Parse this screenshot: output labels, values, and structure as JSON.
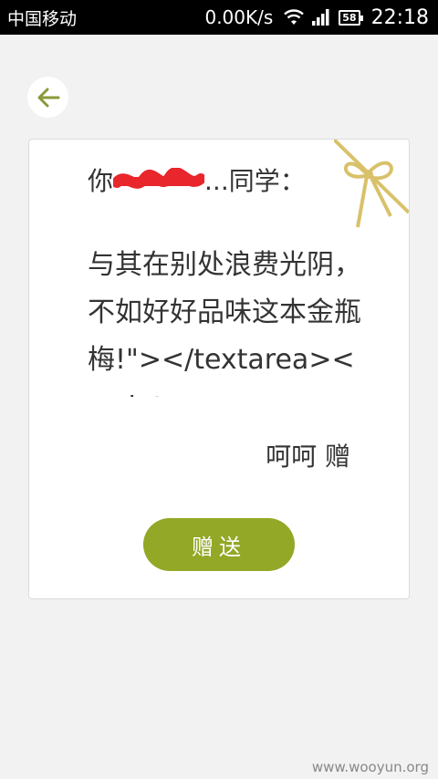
{
  "status_bar": {
    "carrier": "中国移动",
    "net_speed": "0.00K/s",
    "battery": "58",
    "time": "22:18"
  },
  "card": {
    "greeting_prefix": "你",
    "greeting_suffix": "...同学：",
    "message": "与其在别处浪费光阴，不如好好品味这本金瓶梅!\"></textarea><script",
    "signature": "呵呵 赠",
    "send_label": "赠送"
  },
  "watermark": "www.wooyun.org",
  "colors": {
    "accent": "#93a826",
    "ribbon": "#d9c16a",
    "redaction": "#e8262c"
  }
}
